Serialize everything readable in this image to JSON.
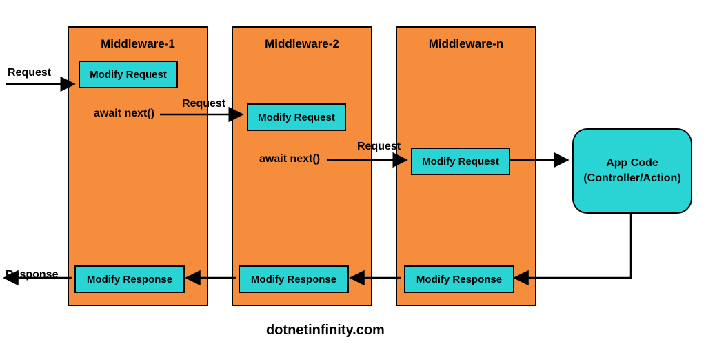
{
  "labels": {
    "request_in": "Request",
    "request_12": "Request",
    "request_2n": "Request",
    "await1": "await next()",
    "await2": "await next()",
    "response_out": "Response"
  },
  "middleware": {
    "m1": {
      "title": "Middleware-1",
      "req": "Modify Request",
      "resp": "Modify Response"
    },
    "m2": {
      "title": "Middleware-2",
      "req": "Modify Request",
      "resp": "Modify Response"
    },
    "mn": {
      "title": "Middleware-n",
      "req": "Modify Request",
      "resp": "Modify Response"
    }
  },
  "app": {
    "line1": "App Code",
    "line2": "(Controller/Action)"
  },
  "footer": "dotnetinfinity.com",
  "colors": {
    "box": "#f58d3c",
    "chip": "#2bd4d4"
  }
}
